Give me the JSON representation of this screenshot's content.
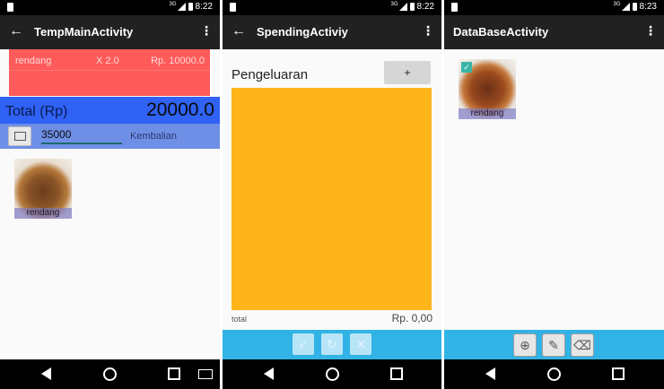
{
  "screens": [
    {
      "status": {
        "time": "8:22",
        "network": "3G"
      },
      "appbar": {
        "title": "TempMainActivity",
        "back_icon": "arrow-left",
        "menu_icon": "more-vert"
      },
      "cart_items": [
        {
          "name": "rendang",
          "qty": "X 2.0",
          "price": "Rp. 10000.0"
        }
      ],
      "total": {
        "label": "Total (Rp)",
        "value": "20000.0"
      },
      "payment": {
        "input_value": "35000",
        "change_label": "Kembalian"
      },
      "menu_items": [
        {
          "caption": "rendang"
        }
      ]
    },
    {
      "status": {
        "time": "8:22",
        "network": "3G"
      },
      "appbar": {
        "title": "SpendingActiviy",
        "back_icon": "arrow-left",
        "menu_icon": "more-vert"
      },
      "page_title": "Pengeluaran",
      "add_button": "+",
      "total_label": "total",
      "total_value": "Rp. 0,00",
      "actions": [
        "check-icon",
        "refresh-icon",
        "close-icon"
      ]
    },
    {
      "status": {
        "time": "8:23",
        "network": "3G"
      },
      "appbar": {
        "title": "DataBaseActivity",
        "menu_icon": "more-vert"
      },
      "items": [
        {
          "caption": "rendang",
          "checked": true
        }
      ],
      "actions": [
        "add-target-icon",
        "edit-pencil-icon",
        "delete-trash-icon"
      ]
    }
  ],
  "navbar": {
    "icons": [
      "back-triangle-icon",
      "home-circle-icon",
      "recents-square-icon"
    ],
    "keyboard_icon": "keyboard-icon"
  },
  "colors": {
    "cart_bg": "#ff5b5b",
    "total_bg": "#2f62f5",
    "payment_bg": "#6f8fe6",
    "chart_bg": "#feb51a",
    "actionbar_bg": "#32b3e6",
    "appbar_bg": "#212121"
  }
}
